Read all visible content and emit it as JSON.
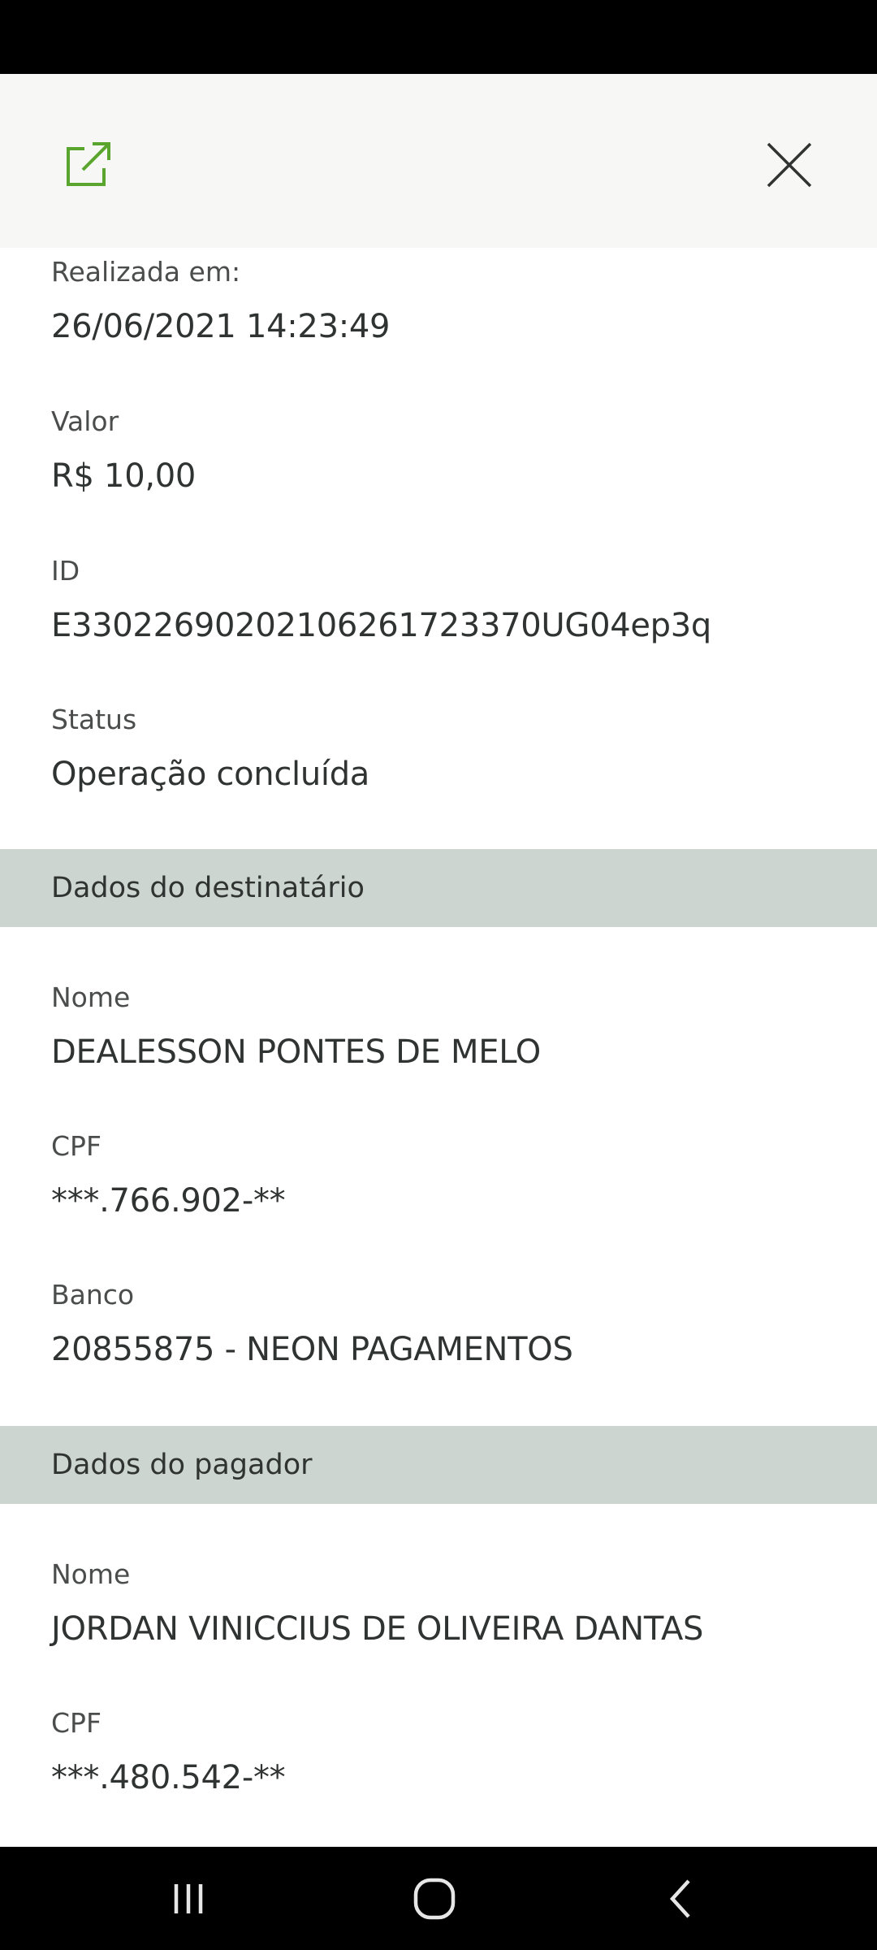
{
  "header": {
    "share_icon": "external-link-icon",
    "close_icon": "close-icon",
    "accent_color": "#5aa52e"
  },
  "transaction": {
    "fields": [
      {
        "label": "Realizada em:",
        "value": "26/06/2021 14:23:49"
      },
      {
        "label": "Valor",
        "value": "R$ 10,00"
      },
      {
        "label": "ID",
        "value": "E33022690202106261723370UG04ep3q"
      },
      {
        "label": "Status",
        "value": "Operação concluída"
      }
    ]
  },
  "recipient": {
    "section_title": "Dados do destinatário",
    "fields": [
      {
        "label": "Nome",
        "value": "DEALESSON PONTES DE MELO"
      },
      {
        "label": "CPF",
        "value": "***.766.902-**"
      },
      {
        "label": "Banco",
        "value": "20855875 - NEON PAGAMENTOS"
      }
    ]
  },
  "payer": {
    "section_title": "Dados do pagador",
    "fields": [
      {
        "label": "Nome",
        "value": "JORDAN VINICCIUS DE OLIVEIRA DANTAS"
      },
      {
        "label": "CPF",
        "value": "***.480.542-**"
      }
    ]
  },
  "nav": {
    "recents_icon": "recents-icon",
    "home_icon": "home-icon",
    "back_icon": "back-icon"
  }
}
